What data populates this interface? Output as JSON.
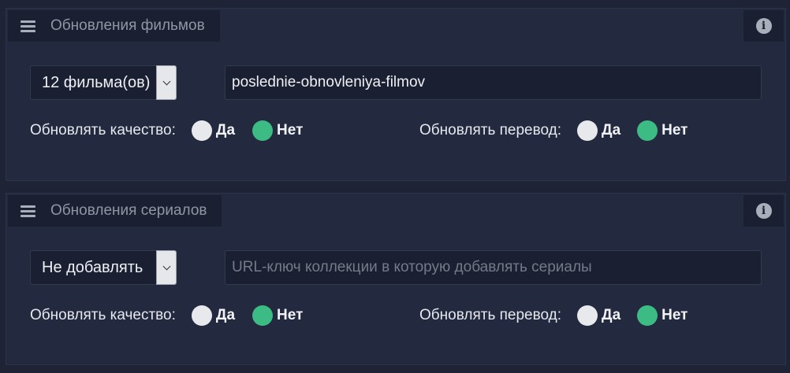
{
  "panels": [
    {
      "title": "Обновления фильмов",
      "select_value": "12 фильма(ов)",
      "input_value": "poslednie-obnovleniya-filmov",
      "input_placeholder": "",
      "quality_label": "Обновлять качество:",
      "translation_label": "Обновлять перевод:",
      "yes": "Да",
      "no": "Нет",
      "quality_selected": "Нет",
      "translation_selected": "Нет"
    },
    {
      "title": "Обновления сериалов",
      "select_value": "Не добавлять",
      "input_value": "",
      "input_placeholder": "URL-ключ коллекции в которую добавлять сериалы",
      "quality_label": "Обновлять качество:",
      "translation_label": "Обновлять перевод:",
      "yes": "Да",
      "no": "Нет",
      "quality_selected": "Нет",
      "translation_selected": "Нет"
    }
  ],
  "icons": {
    "menu": "hamburger-menu-icon",
    "info": "info-circle-icon"
  },
  "colors": {
    "radio_on": "#3dbb84",
    "radio_off": "#e8e9ec"
  }
}
